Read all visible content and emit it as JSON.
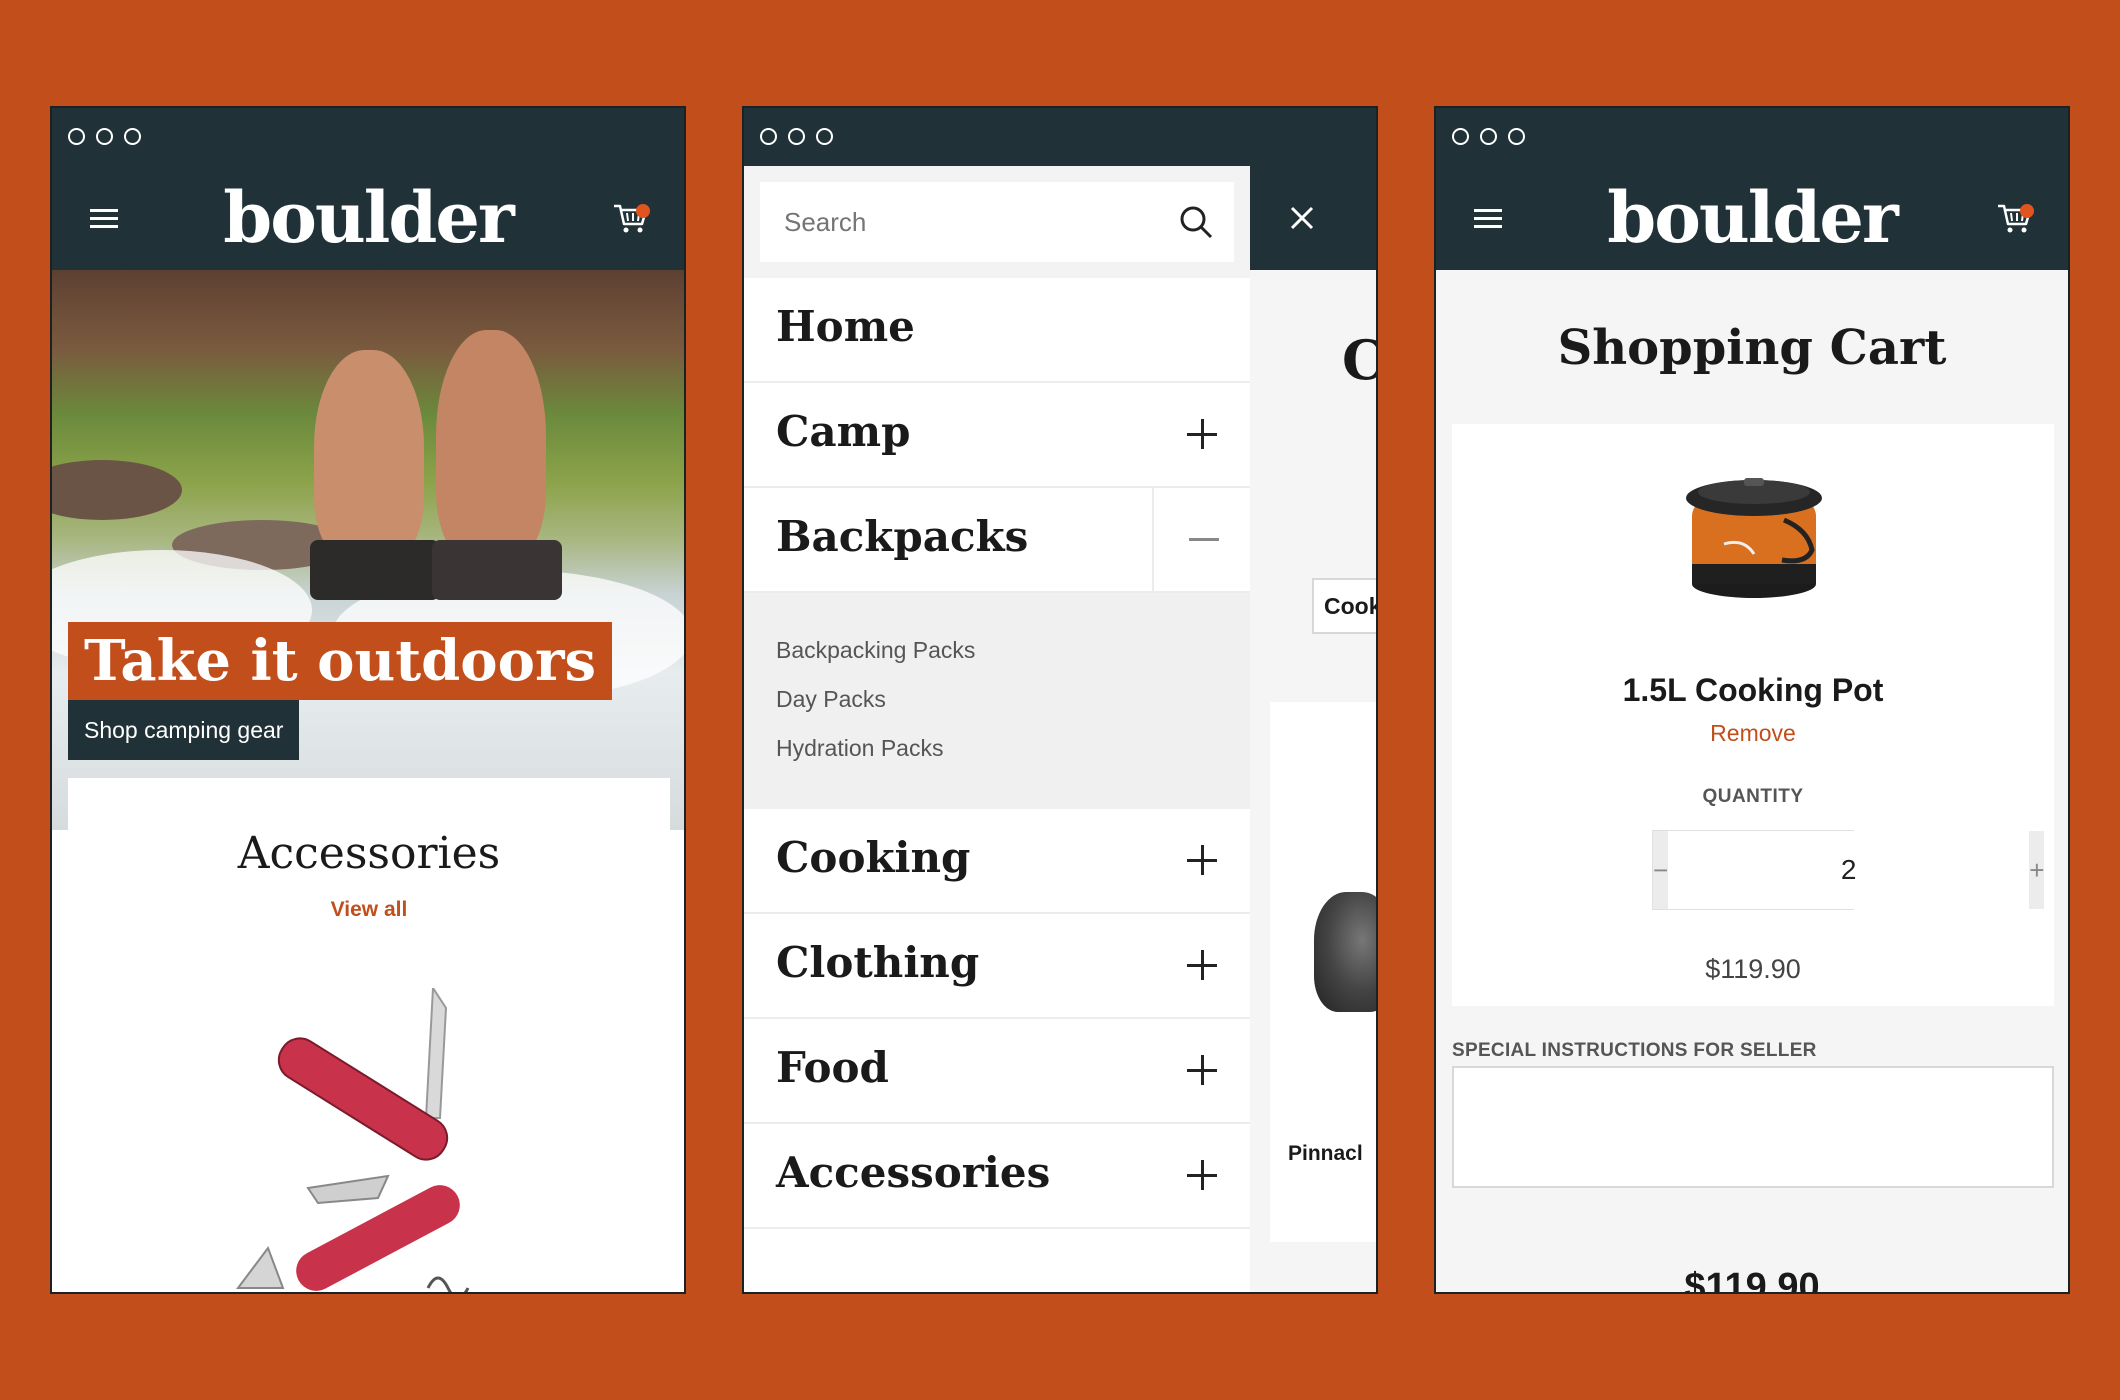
{
  "brand": {
    "logo_text": "boulder",
    "accent": "#c24e1c",
    "dark": "#203238"
  },
  "home": {
    "hero_title": "Take it outdoors",
    "hero_cta": "Shop camping gear",
    "section_title": "Accessories",
    "section_link": "View all"
  },
  "menu": {
    "search_placeholder": "Search",
    "items": [
      {
        "label": "Home",
        "toggle": "none"
      },
      {
        "label": "Camp",
        "toggle": "plus"
      },
      {
        "label": "Backpacks",
        "toggle": "minus"
      },
      {
        "label": "Cooking",
        "toggle": "plus"
      },
      {
        "label": "Clothing",
        "toggle": "plus"
      },
      {
        "label": "Food",
        "toggle": "plus"
      },
      {
        "label": "Accessories",
        "toggle": "plus"
      }
    ],
    "subitems": [
      "Backpacking Packs",
      "Day Packs",
      "Hydration Packs"
    ],
    "behind": {
      "heading_fragment": "C",
      "tab_fragment": "Cook",
      "product_fragment": "Pinnacl"
    }
  },
  "cart": {
    "title": "Shopping Cart",
    "item_name": "1.5L Cooking Pot",
    "remove_label": "Remove",
    "quantity_label": "QUANTITY",
    "quantity": "2",
    "minus": "−",
    "plus": "+",
    "item_price": "$119.90",
    "instructions_label": "SPECIAL INSTRUCTIONS FOR SELLER",
    "total": "$119.90"
  }
}
